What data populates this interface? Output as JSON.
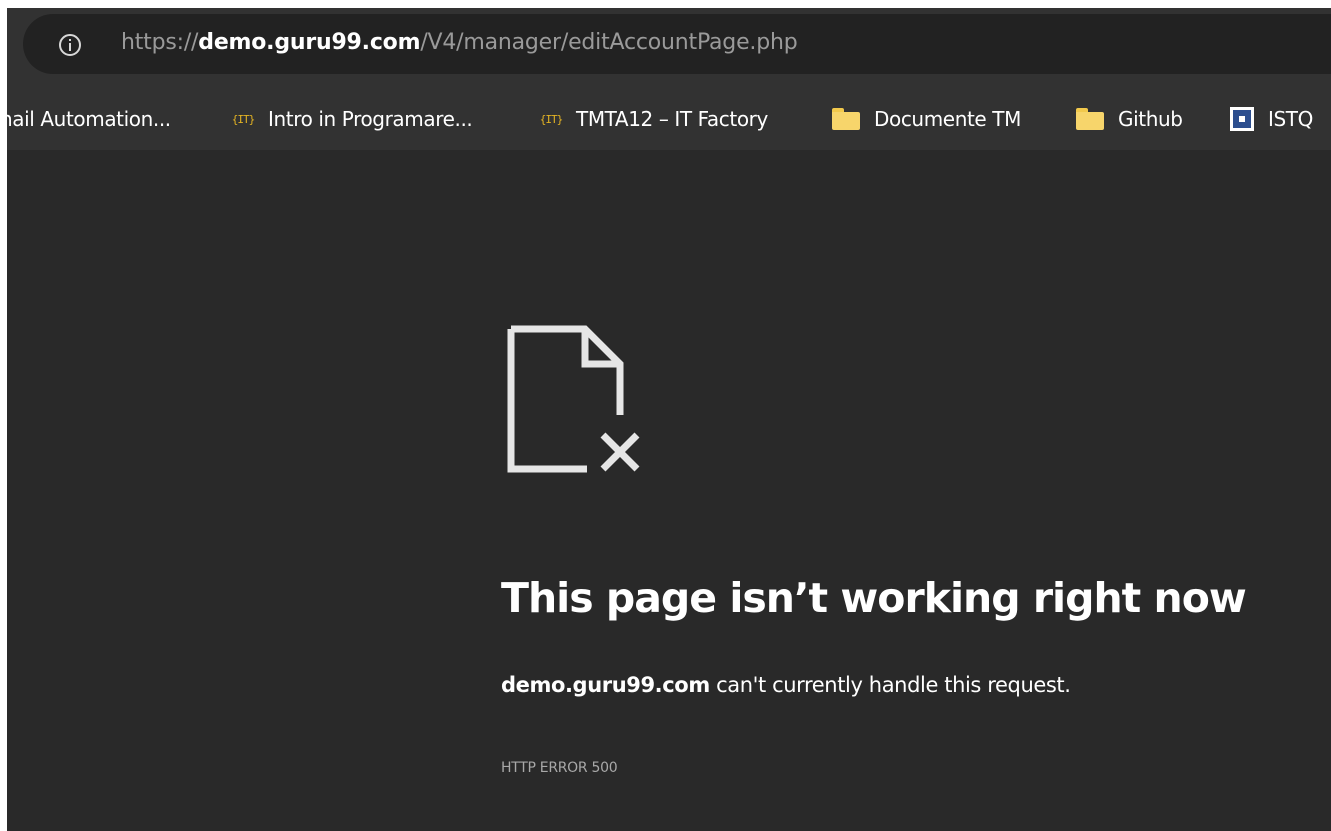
{
  "address_bar": {
    "url_prefix": "https://",
    "url_host": "demo.guru99.com",
    "url_path": "/V4/manager/editAccountPage.php",
    "security_icon": "info-icon"
  },
  "bookmarks": [
    {
      "label": "nail Automation...",
      "icon": "none"
    },
    {
      "label": "Intro in Programare...",
      "icon": "it-factory-icon"
    },
    {
      "label": "TMTA12 – IT Factory",
      "icon": "it-factory-icon"
    },
    {
      "label": "Documente TM",
      "icon": "folder-icon"
    },
    {
      "label": "Github",
      "icon": "folder-icon"
    },
    {
      "label": "ISTQ",
      "icon": "istqb-icon"
    }
  ],
  "error": {
    "icon": "broken-document-icon",
    "title": "This page isn’t working right now",
    "host": "demo.guru99.com",
    "message": " can't currently handle this request.",
    "code": "HTTP ERROR 500"
  },
  "colors": {
    "page_background": "#292929",
    "toolbar_background": "#323232",
    "omnibox_background": "#222222",
    "bookmark_accent": "#e3b324",
    "folder": "#f7d56b"
  }
}
